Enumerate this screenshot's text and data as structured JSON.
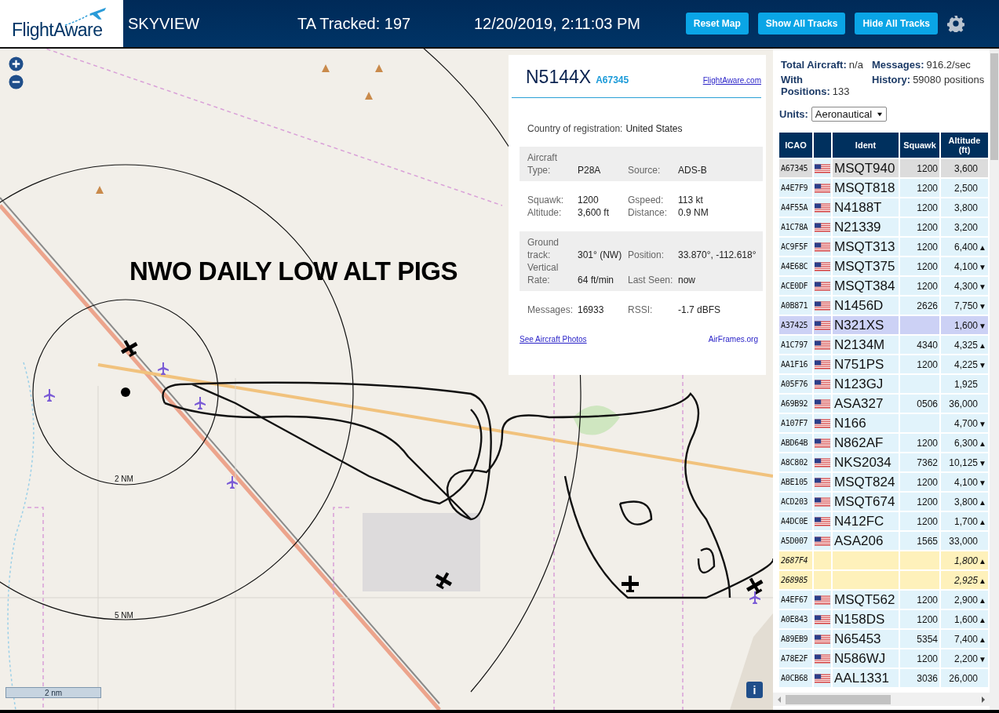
{
  "header": {
    "logo": "FlightAware",
    "app_name": "SKYVIEW",
    "tracked": "TA Tracked: 197",
    "datetime": "12/20/2019, 2:11:03 PM",
    "buttons": [
      "Reset Map",
      "Show All Tracks",
      "Hide All Tracks"
    ]
  },
  "map": {
    "annotation": "NWO DAILY LOW ALT PIGS",
    "range_rings": [
      {
        "label": "2 NM"
      },
      {
        "label": "5 NM"
      }
    ],
    "scale": "2 nm",
    "info_button": "i"
  },
  "popup": {
    "ident": "N5144X",
    "icao": "A67345",
    "site_link": "FlightAware.com",
    "country_label": "Country of registration:",
    "country": "United States",
    "sections": [
      {
        "shaded": true,
        "rows": [
          [
            "Aircraft Type:",
            "P28A",
            "Source:",
            "ADS-B"
          ]
        ]
      },
      {
        "shaded": false,
        "rows": [
          [
            "Squawk:",
            "1200",
            "Gspeed:",
            "113 kt"
          ],
          [
            "Altitude:",
            "3,600 ft",
            "Distance:",
            "0.9 NM"
          ]
        ]
      },
      {
        "shaded": true,
        "rows": [
          [
            "Ground track:",
            "301° (NW)",
            "Position:",
            "33.870°, -112.618°"
          ],
          [
            "Vertical Rate:",
            "64 ft/min",
            "Last Seen:",
            "now"
          ]
        ]
      },
      {
        "shaded": false,
        "rows": [
          [
            "Messages:",
            "16933",
            "RSSI:",
            "-1.7 dBFS"
          ]
        ]
      }
    ],
    "photos_link": "See Aircraft Photos",
    "airframes_link": "AirFrames.org"
  },
  "stats": [
    {
      "label": "Total Aircraft:",
      "value": "n/a"
    },
    {
      "label": "Messages:",
      "value": "916.2/sec"
    },
    {
      "label": "With Positions:",
      "value": "133"
    },
    {
      "label": "History:",
      "value": "59080 positions"
    }
  ],
  "units": {
    "label": "Units:",
    "value": "Aeronautical"
  },
  "table": {
    "columns": [
      "ICAO",
      "",
      "Ident",
      "Squawk",
      "Altitude (ft)"
    ],
    "rows": [
      {
        "icao": "A67345",
        "kind": "adsb",
        "ident": "MSQT940",
        "squawk": "1200",
        "altitude": "3,600",
        "selected": true,
        "highlighted": false
      },
      {
        "icao": "A4E7F9",
        "kind": "adsb",
        "ident": "MSQT818",
        "squawk": "1200",
        "altitude": "2,500",
        "selected": false,
        "highlighted": false
      },
      {
        "icao": "A4F55A",
        "kind": "adsb",
        "ident": "N4188T",
        "squawk": "1200",
        "altitude": "3,800",
        "selected": false,
        "highlighted": false
      },
      {
        "icao": "A1C78A",
        "kind": "adsb",
        "ident": "N21339",
        "squawk": "1200",
        "altitude": "3,200",
        "selected": false,
        "highlighted": false
      },
      {
        "icao": "AC9F5F",
        "kind": "adsb",
        "ident": "MSQT313",
        "squawk": "1200",
        "altitude": "6,400",
        "trend": "▲",
        "selected": false,
        "highlighted": false
      },
      {
        "icao": "A4E68C",
        "kind": "adsb",
        "ident": "MSQT375",
        "squawk": "1200",
        "altitude": "4,100",
        "trend": "▼",
        "selected": false,
        "highlighted": false
      },
      {
        "icao": "ACE0DF",
        "kind": "adsb",
        "ident": "MSQT384",
        "squawk": "1200",
        "altitude": "4,300",
        "trend": "▼",
        "selected": false,
        "highlighted": false
      },
      {
        "icao": "A0B871",
        "kind": "adsb",
        "ident": "N1456D",
        "squawk": "2626",
        "altitude": "7,750",
        "trend": "▼",
        "selected": false,
        "highlighted": false
      },
      {
        "icao": "A37425",
        "kind": "adsb",
        "ident": "N321XS",
        "altitude": "1,600",
        "trend": "▼",
        "selected": false,
        "highlighted": true
      },
      {
        "icao": "A1C797",
        "kind": "adsb",
        "ident": "N2134M",
        "squawk": "4340",
        "altitude": "4,325",
        "trend": "▲",
        "selected": false,
        "highlighted": false
      },
      {
        "icao": "AA1F16",
        "kind": "adsb",
        "ident": "N751PS",
        "squawk": "1200",
        "altitude": "4,225",
        "trend": "▼",
        "selected": false,
        "highlighted": false
      },
      {
        "icao": "A05F76",
        "kind": "adsb",
        "ident": "N123GJ",
        "altitude": "1,925",
        "selected": false,
        "highlighted": false
      },
      {
        "icao": "A69B92",
        "kind": "adsb",
        "ident": "ASA327",
        "squawk": "0506",
        "altitude": "36,000",
        "selected": false,
        "highlighted": false
      },
      {
        "icao": "A107F7",
        "kind": "adsb",
        "ident": "N166",
        "altitude": "4,700",
        "trend": "▼",
        "selected": false,
        "highlighted": false
      },
      {
        "icao": "ABD64B",
        "kind": "adsb",
        "ident": "N862AF",
        "squawk": "1200",
        "altitude": "6,300",
        "trend": "▲",
        "selected": false,
        "highlighted": false
      },
      {
        "icao": "A8C802",
        "kind": "adsb",
        "ident": "NKS2034",
        "squawk": "7362",
        "altitude": "10,125",
        "trend": "▼",
        "selected": false,
        "highlighted": false
      },
      {
        "icao": "ABE105",
        "kind": "adsb",
        "ident": "MSQT824",
        "squawk": "1200",
        "altitude": "4,100",
        "trend": "▼",
        "selected": false,
        "highlighted": false
      },
      {
        "icao": "ACD203",
        "kind": "adsb",
        "ident": "MSQT674",
        "squawk": "1200",
        "altitude": "3,800",
        "trend": "▲",
        "selected": false,
        "highlighted": false
      },
      {
        "icao": "A4DC0E",
        "kind": "adsb",
        "ident": "N412FC",
        "squawk": "1200",
        "altitude": "1,700",
        "trend": "▲",
        "selected": false,
        "highlighted": false
      },
      {
        "icao": "A5D007",
        "kind": "adsb",
        "ident": "ASA206",
        "squawk": "1565",
        "altitude": "33,000",
        "selected": false,
        "highlighted": false
      },
      {
        "icao": "2687F4",
        "kind": "other",
        "altitude": "1,800",
        "trend": "▲",
        "selected": false,
        "highlighted": false
      },
      {
        "icao": "268985",
        "kind": "other",
        "altitude": "2,925",
        "trend": "▲",
        "selected": false,
        "highlighted": false
      },
      {
        "icao": "A4EF67",
        "kind": "adsb",
        "ident": "MSQT562",
        "squawk": "1200",
        "altitude": "2,900",
        "trend": "▲",
        "selected": false,
        "highlighted": false
      },
      {
        "icao": "A0E843",
        "kind": "adsb",
        "ident": "N158DS",
        "squawk": "1200",
        "altitude": "1,600",
        "trend": "▲",
        "selected": false,
        "highlighted": false
      },
      {
        "icao": "A89EB9",
        "kind": "adsb",
        "ident": "N65453",
        "squawk": "5354",
        "altitude": "7,400",
        "trend": "▲",
        "selected": false,
        "highlighted": false
      },
      {
        "icao": "A78E2F",
        "kind": "adsb",
        "ident": "N586WJ",
        "squawk": "1200",
        "altitude": "2,200",
        "trend": "▼",
        "selected": false,
        "highlighted": false
      },
      {
        "icao": "A0CB68",
        "kind": "adsb",
        "ident": "AAL1331",
        "squawk": "3036",
        "altitude": "26,000",
        "selected": false,
        "highlighted": false
      }
    ]
  }
}
